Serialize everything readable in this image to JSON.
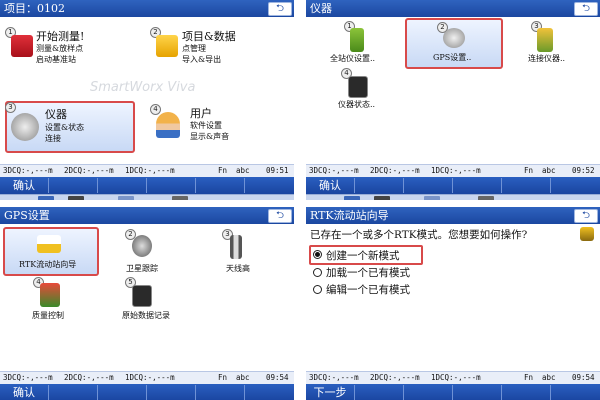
{
  "panel1": {
    "title": "项目：0102",
    "menu": [
      {
        "num": "1",
        "title": "开始测量!",
        "line1": "测量&放样点",
        "line2": "启动基准站"
      },
      {
        "num": "2",
        "title": "项目&数据",
        "line1": "点管理",
        "line2": "导入&导出"
      },
      {
        "num": "3",
        "title": "仪器",
        "line1": "设置&状态",
        "line2": "连接"
      },
      {
        "num": "4",
        "title": "用户",
        "line1": "软件设置",
        "line2": "显示&声音"
      }
    ],
    "watermark": "SmartWorx Viva",
    "status": {
      "dcq3": "3DCQ:-,---m",
      "dcq2": "2DCQ:-,---m",
      "dcq1": "1DCQ:-,---m",
      "fn": "Fn",
      "abc": "abc",
      "time": "09:51"
    },
    "softkey": "确认"
  },
  "panel2": {
    "title": "仪器",
    "items": [
      {
        "num": "1",
        "label": "全站仪设置.."
      },
      {
        "num": "2",
        "label": "GPS设置.."
      },
      {
        "num": "3",
        "label": "连接仪器.."
      },
      {
        "num": "4",
        "label": "仪器状态.."
      }
    ],
    "status": {
      "dcq3": "3DCQ:-,---m",
      "dcq2": "2DCQ:-,---m",
      "dcq1": "1DCQ:-,---m",
      "fn": "Fn",
      "abc": "abc",
      "time": "09:52"
    },
    "softkey": "确认"
  },
  "panel3": {
    "title": "GPS设置",
    "items": [
      {
        "num": "1",
        "label": "RTK流动站向导"
      },
      {
        "num": "2",
        "label": "卫星跟踪"
      },
      {
        "num": "3",
        "label": "天线高"
      },
      {
        "num": "4",
        "label": "质量控制"
      },
      {
        "num": "5",
        "label": "原始数据记录"
      }
    ],
    "status": {
      "dcq3": "3DCQ:-,---m",
      "dcq2": "2DCQ:-,---m",
      "dcq1": "1DCQ:-,---m",
      "fn": "Fn",
      "abc": "abc",
      "time": "09:54"
    },
    "softkey": "确认"
  },
  "panel4": {
    "title": "RTK流动站向导",
    "question": "已存在一个或多个RTK模式。您想要如何操作?",
    "options": [
      {
        "label": "创建一个新模式",
        "selected": true
      },
      {
        "label": "加载一个已有模式",
        "selected": false
      },
      {
        "label": "编辑一个已有模式",
        "selected": false
      }
    ],
    "status": {
      "dcq3": "3DCQ:-,---m",
      "dcq2": "2DCQ:-,---m",
      "dcq1": "1DCQ:-,---m",
      "fn": "Fn",
      "abc": "abc",
      "time": "09:54"
    },
    "softkey": "下一步"
  },
  "back_glyph": "⮌",
  "toolbar_icons": [
    "satellite-icon",
    "gps-receiver-icon",
    "sd-card-icon",
    "camera-icon",
    "prism-icon",
    "sd-memory-icon",
    "battery-icon"
  ],
  "colors": {
    "titlebar": "#1b47a0",
    "softkeys": "#1a45a0",
    "selection_border": "#d84a4a",
    "toolbar": "#c9d6ee"
  }
}
